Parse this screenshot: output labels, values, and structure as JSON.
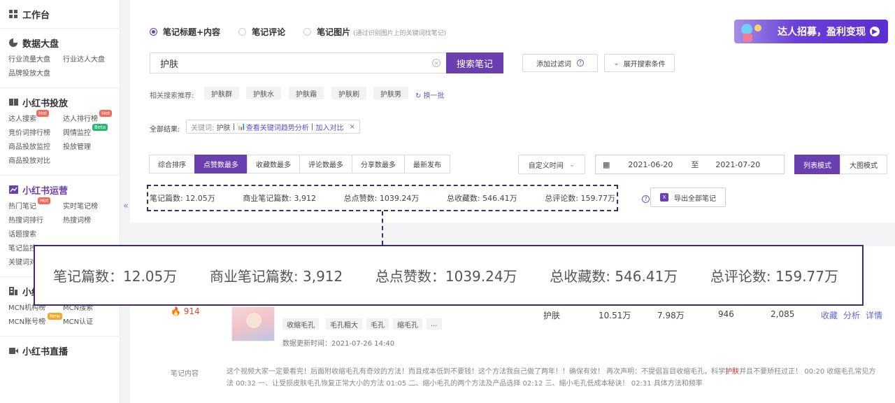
{
  "sidebar": {
    "workbench": "工作台",
    "sections": [
      {
        "title": "数据大盘",
        "items": [
          {
            "label": "行业流量大盘"
          },
          {
            "label": "行业达人大盘"
          },
          {
            "label": "品牌投放大盘"
          }
        ]
      },
      {
        "title": "小红书投放",
        "items": [
          {
            "label": "达人搜索",
            "badge": "Hot"
          },
          {
            "label": "达人排行榜",
            "badge": "Hot"
          },
          {
            "label": "竞价词排行榜"
          },
          {
            "label": "舆情监控",
            "badge": "Beta"
          },
          {
            "label": "商品投放监控"
          },
          {
            "label": "投放管理"
          },
          {
            "label": "商品投放对比"
          }
        ]
      },
      {
        "title": "小红书运营",
        "items": [
          {
            "label": "热门笔记",
            "badge": "Hot"
          },
          {
            "label": "实时笔记榜"
          },
          {
            "label": "热搜词排行"
          },
          {
            "label": "热搜词榜"
          },
          {
            "label": "话题搜索"
          },
          {
            "label": "笔记监控"
          },
          {
            "label": "关键词对比"
          }
        ]
      },
      {
        "title": "小红书MCN",
        "items": [
          {
            "label": "MCN机构榜"
          },
          {
            "label": "MCN搜索"
          },
          {
            "label": "MCN账号榜",
            "badge": "New"
          },
          {
            "label": "MCN认证"
          }
        ]
      },
      {
        "title": "小红书直播"
      }
    ]
  },
  "search": {
    "radios": [
      {
        "label": "笔记标题+内容",
        "checked": true
      },
      {
        "label": "笔记评论",
        "checked": false
      },
      {
        "label": "笔记图片",
        "checked": false,
        "note": "(通过识别图片上的关键词找笔记)"
      }
    ],
    "value": "护肤",
    "button": "搜索笔记",
    "add_filter": "添加过滤词",
    "expand": "展开搜索条件"
  },
  "banner": {
    "text": "达人招募，盈利变现"
  },
  "related": {
    "label": "相关搜索推荐:",
    "chips": [
      "护肤群",
      "护肤水",
      "护肤霜",
      "护肤刷",
      "护肤男"
    ],
    "refresh": "换一批"
  },
  "results": {
    "label": "全部结果:",
    "tag_prefix": "关键词:",
    "tag_keyword": "护肤",
    "trend_link": "查看关键词趋势分析",
    "compare_link": "加入对比",
    "close": "×"
  },
  "sort": {
    "tabs": [
      "综合排序",
      "点赞数最多",
      "收藏数最多",
      "评论数最多",
      "分享数最多",
      "最新发布"
    ],
    "active": 1,
    "custom_time": "自定义时间",
    "date_from": "2021-06-20",
    "date_to_sep": "至",
    "date_to": "2021-07-20",
    "list_mode": "列表模式",
    "grid_mode": "大图模式"
  },
  "stats": {
    "notes": "笔记篇数: 12.05万",
    "commercial": "商业笔记篇数: 3,912",
    "likes": "总点赞数: 1039.24万",
    "collects": "总收藏数: 546.41万",
    "comments": "总评论数: 159.77万",
    "export": "导出全部笔记",
    "help": "?"
  },
  "zoom": {
    "notes": "笔记篇数：12.05万",
    "commercial": "商业笔记篇数: 3,912",
    "likes": "总点赞数：1039.24万",
    "collects": "总收藏数: 546.41万",
    "comments": "总评论数: 159.77万"
  },
  "row": {
    "hot": "914",
    "tags": [
      "收缩毛孔",
      "毛孔粗大",
      "毛孔",
      "缩毛孔",
      "..."
    ],
    "updated": "数据更新时间：2021-07-26 14:40",
    "keyword": "护肤",
    "likes": "10.51万",
    "collects": "7.98万",
    "comments": "946",
    "shares": "2,085",
    "actions": [
      "收藏",
      "分析",
      "详情"
    ]
  },
  "content": {
    "label": "笔记内容",
    "text_before": "这个视频大家一定要看完！后面附收缩毛孔有奇效的方法！而且成本低到不要钱！这个方法我自己做了两年！！确保有效！ 再次声明：不提倡盲目收缩毛孔，科学",
    "highlight": "护肤",
    "text_after": "并且不要矫枉过正！ 00:20 收缩毛孔常见方法 00:32 一、让受损皮肤毛孔恢复正常大小的方法 01:05 二、缩小毛孔的两个方法及产品选择 02:12 三、缩小毛孔低成本秘诀！ 02:31 具体方法和频率"
  }
}
